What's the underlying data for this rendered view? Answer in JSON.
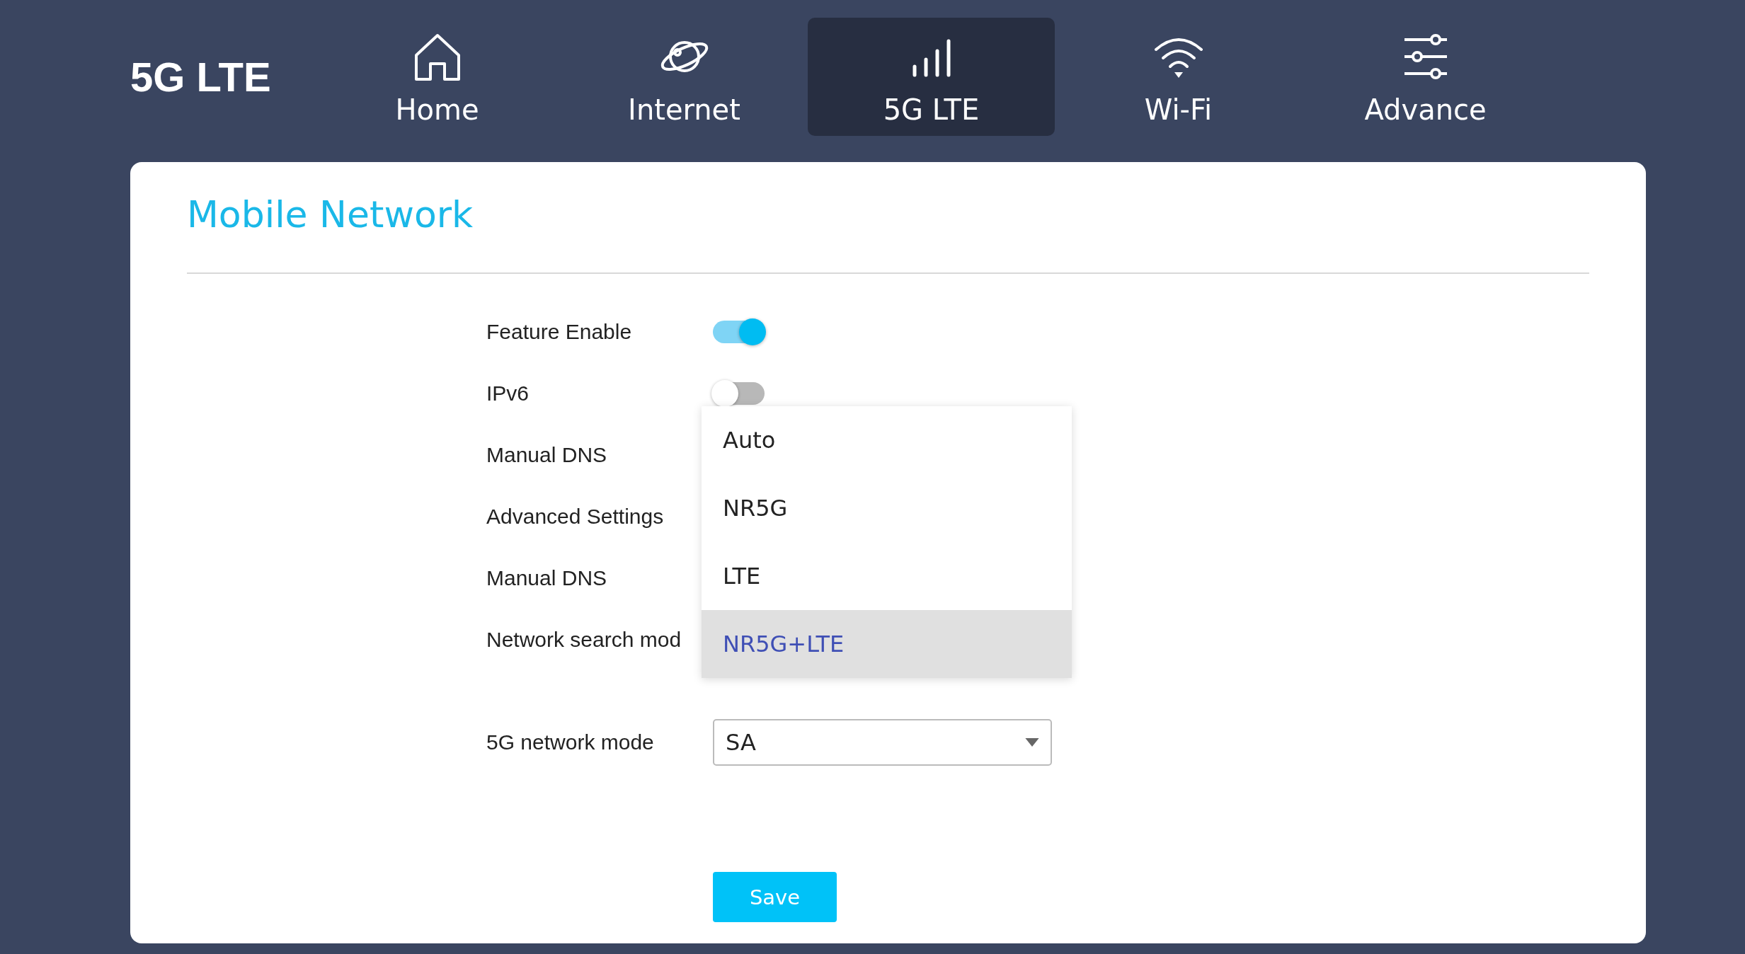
{
  "brand": "5G LTE",
  "nav": [
    {
      "label": "Home",
      "kind": "home",
      "selected": false
    },
    {
      "label": "Internet",
      "kind": "planet",
      "selected": false
    },
    {
      "label": "5G LTE",
      "kind": "signal",
      "selected": true
    },
    {
      "label": "Wi-Fi",
      "kind": "wifi",
      "selected": false
    },
    {
      "label": "Advance",
      "kind": "sliders",
      "selected": false
    }
  ],
  "card": {
    "title": "Mobile Network"
  },
  "settings": [
    {
      "kind": "toggle",
      "label": "Feature Enable",
      "on": true
    },
    {
      "kind": "toggle",
      "label": "IPv6",
      "on": false
    },
    {
      "kind": "blank",
      "label": "Manual DNS"
    },
    {
      "kind": "blank",
      "label": "Advanced Settings"
    },
    {
      "kind": "blank",
      "label": "Manual DNS"
    },
    {
      "kind": "menu",
      "label": "Network search mod",
      "options": [
        {
          "label": "Auto",
          "selected": false
        },
        {
          "label": "NR5G",
          "selected": false
        },
        {
          "label": "LTE",
          "selected": false
        },
        {
          "label": "NR5G+LTE",
          "selected": true
        }
      ]
    },
    {
      "kind": "select",
      "label": "5G network mode",
      "value": "SA"
    }
  ],
  "save": "Save"
}
